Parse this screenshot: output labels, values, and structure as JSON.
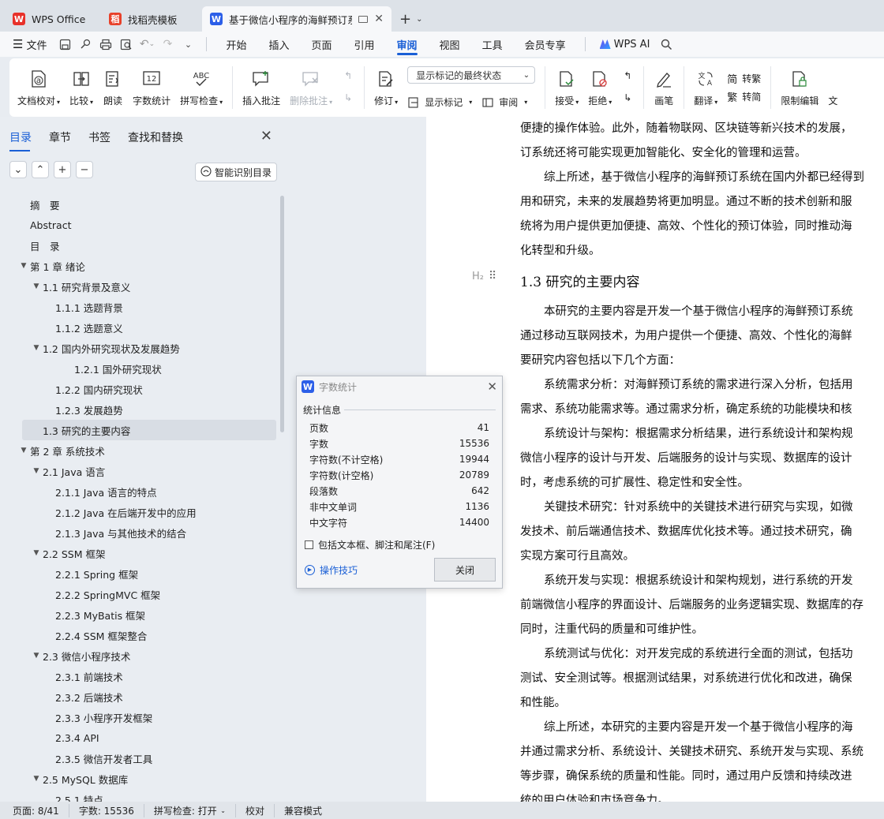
{
  "tabs": [
    {
      "label": "WPS Office",
      "icon": "wps-logo-icon"
    },
    {
      "label": "找稻壳模板",
      "icon": "docer-logo-icon"
    },
    {
      "label": "基于微信小程序的海鲜预订系",
      "icon": "wps-writer-logo-icon",
      "active": true
    }
  ],
  "menubar": {
    "file": "文件",
    "items": [
      "开始",
      "插入",
      "页面",
      "引用",
      "审阅",
      "视图",
      "工具",
      "会员专享"
    ],
    "active": "审阅",
    "ai": "WPS AI"
  },
  "ribbon": {
    "doc_check": "文档校对",
    "compare": "比较",
    "read_aloud": "朗读",
    "word_count": "字数统计",
    "spell_check": "拼写检查",
    "insert_comment": "插入批注",
    "delete_comment": "删除批注",
    "track_changes": "修订",
    "markup_select": "显示标记的最终状态",
    "show_markup": "显示标记",
    "review": "审阅",
    "accept": "接受",
    "reject": "拒绝",
    "pen": "画笔",
    "translate": "翻译",
    "to_traditional": "转繁",
    "to_simplified": "转简",
    "restrict_edit": "限制编辑",
    "more": "文"
  },
  "sidebar": {
    "tabs": [
      "目录",
      "章节",
      "书签",
      "查找和替换"
    ],
    "active_tab": "目录",
    "smart_button": "智能识别目录",
    "toc": [
      {
        "label": "摘　要",
        "level": 0,
        "arrow": false
      },
      {
        "label": "Abstract",
        "level": 0,
        "arrow": false
      },
      {
        "label": "目　录",
        "level": 0,
        "arrow": false
      },
      {
        "label": "第 1 章  绪论",
        "level": 0,
        "arrow": true
      },
      {
        "label": "1.1  研究背景及意义",
        "level": 1,
        "arrow": true
      },
      {
        "label": "1.1.1  选题背景",
        "level": 2,
        "arrow": false
      },
      {
        "label": "1.1.2  选题意义",
        "level": 2,
        "arrow": false
      },
      {
        "label": "1.2  国内外研究现状及发展趋势",
        "level": 1,
        "arrow": true
      },
      {
        "label": "1.2.1  国外研究现状",
        "level": 3,
        "arrow": false
      },
      {
        "label": "1.2.2  国内研究现状",
        "level": 2,
        "arrow": false
      },
      {
        "label": "1.2.3  发展趋势",
        "level": 2,
        "arrow": false
      },
      {
        "label": "1.3  研究的主要内容",
        "level": 1,
        "arrow": false,
        "selected": true
      },
      {
        "label": "第 2 章  系统技术",
        "level": 0,
        "arrow": true
      },
      {
        "label": "2.1 Java 语言",
        "level": 1,
        "arrow": true
      },
      {
        "label": "2.1.1 Java 语言的特点",
        "level": 2,
        "arrow": false
      },
      {
        "label": "2.1.2 Java 在后端开发中的应用",
        "level": 2,
        "arrow": false
      },
      {
        "label": "2.1.3 Java 与其他技术的结合",
        "level": 2,
        "arrow": false
      },
      {
        "label": "2.2 SSM 框架",
        "level": 1,
        "arrow": true
      },
      {
        "label": "2.2.1 Spring 框架",
        "level": 2,
        "arrow": false
      },
      {
        "label": "2.2.2 SpringMVC 框架",
        "level": 2,
        "arrow": false
      },
      {
        "label": "2.2.3 MyBatis 框架",
        "level": 2,
        "arrow": false
      },
      {
        "label": "2.2.4 SSM 框架整合",
        "level": 2,
        "arrow": false
      },
      {
        "label": "2.3  微信小程序技术",
        "level": 1,
        "arrow": true
      },
      {
        "label": "2.3.1  前端技术",
        "level": 2,
        "arrow": false
      },
      {
        "label": "2.3.2  后端技术",
        "level": 2,
        "arrow": false
      },
      {
        "label": "2.3.3  小程序开发框架",
        "level": 2,
        "arrow": false
      },
      {
        "label": "2.3.4 API",
        "level": 2,
        "arrow": false
      },
      {
        "label": "2.3.5  微信开发者工具",
        "level": 2,
        "arrow": false
      },
      {
        "label": "2.5 MySQL 数据库",
        "level": 1,
        "arrow": true
      },
      {
        "label": "2.5.1  特点",
        "level": 2,
        "arrow": false
      }
    ]
  },
  "document": {
    "lines_before": [
      {
        "text": "便捷的操作体验。此外，随着物联网、区块链等新兴技术的发展，",
        "indent": false
      },
      {
        "text": "订系统还将可能实现更加智能化、安全化的管理和运营。",
        "indent": false
      },
      {
        "text": "综上所述，基于微信小程序的海鲜预订系统在国内外都已经得到",
        "indent": true
      },
      {
        "text": "用和研究，未来的发展趋势将更加明显。通过不断的技术创新和服",
        "indent": false
      },
      {
        "text": "统将为用户提供更加便捷、高效、个性化的预订体验，同时推动海",
        "indent": false
      },
      {
        "text": "化转型和升级。",
        "indent": false
      }
    ],
    "heading_mark": "H₂",
    "heading": "1.3  研究的主要内容",
    "lines_after": [
      {
        "text": "本研究的主要内容是开发一个基于微信小程序的海鲜预订系统",
        "indent": true
      },
      {
        "text": "通过移动互联网技术，为用户提供一个便捷、高效、个性化的海鲜",
        "indent": false
      },
      {
        "text": "要研究内容包括以下几个方面：",
        "indent": false
      },
      {
        "text": "系统需求分析：对海鲜预订系统的需求进行深入分析，包括用",
        "indent": true
      },
      {
        "text": "需求、系统功能需求等。通过需求分析，确定系统的功能模块和核",
        "indent": false
      },
      {
        "text": "系统设计与架构：根据需求分析结果，进行系统设计和架构规",
        "indent": true
      },
      {
        "text": "微信小程序的设计与开发、后端服务的设计与实现、数据库的设计",
        "indent": false
      },
      {
        "text": "时，考虑系统的可扩展性、稳定性和安全性。",
        "indent": false
      },
      {
        "text": "关键技术研究：针对系统中的关键技术进行研究与实现，如微",
        "indent": true
      },
      {
        "text": "发技术、前后端通信技术、数据库优化技术等。通过技术研究，确",
        "indent": false
      },
      {
        "text": "实现方案可行且高效。",
        "indent": false
      },
      {
        "text": "系统开发与实现：根据系统设计和架构规划，进行系统的开发",
        "indent": true
      },
      {
        "text": "前端微信小程序的界面设计、后端服务的业务逻辑实现、数据库的存",
        "indent": false
      },
      {
        "text": "同时，注重代码的质量和可维护性。",
        "indent": false
      },
      {
        "text": "系统测试与优化：对开发完成的系统进行全面的测试，包括功",
        "indent": true
      },
      {
        "text": "测试、安全测试等。根据测试结果，对系统进行优化和改进，确保",
        "indent": false
      },
      {
        "text": "和性能。",
        "indent": false
      },
      {
        "text": "综上所述，本研究的主要内容是开发一个基于微信小程序的海",
        "indent": true
      },
      {
        "text": "并通过需求分析、系统设计、关键技术研究、系统开发与实现、系统",
        "indent": false
      },
      {
        "text": "等步骤，确保系统的质量和性能。同时，通过用户反馈和持续改进",
        "indent": false
      },
      {
        "text": "统的用户体验和市场竞争力。",
        "indent": false
      }
    ]
  },
  "dialog": {
    "title": "字数统计",
    "section": "统计信息",
    "stats": [
      {
        "label": "页数",
        "value": "41"
      },
      {
        "label": "字数",
        "value": "15536"
      },
      {
        "label": "字符数(不计空格)",
        "value": "19944"
      },
      {
        "label": "字符数(计空格)",
        "value": "20789"
      },
      {
        "label": "段落数",
        "value": "642"
      },
      {
        "label": "非中文单词",
        "value": "1136"
      },
      {
        "label": "中文字符",
        "value": "14400"
      }
    ],
    "checkbox_label": "包括文本框、脚注和尾注(F)",
    "tips": "操作技巧",
    "close_button": "关闭"
  },
  "statusbar": {
    "page": "页面: 8/41",
    "words": "字数: 15536",
    "spell": "拼写检查: 打开",
    "proofread": "校对",
    "compat": "兼容模式"
  }
}
